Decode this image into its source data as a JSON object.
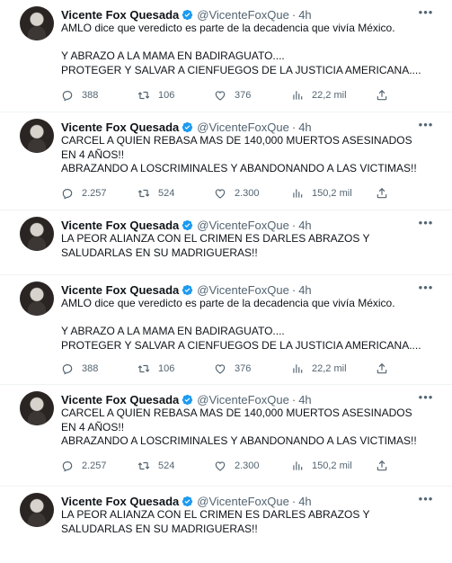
{
  "tweets": [
    {
      "name": "Vicente Fox Quesada",
      "handle": "@VicenteFoxQue",
      "time": "4h",
      "lines": [
        "AMLO dice que veredicto es parte de la decadencia que vivía México.",
        "",
        "Y ABRAZO A LA MAMA EN BADIRAGUATO....",
        "PROTEGER Y SALVAR A CIENFUEGOS DE LA JUSTICIA AMERICANA...."
      ],
      "replies": "388",
      "retweets": "106",
      "likes": "376",
      "views": "22,2 mil"
    },
    {
      "name": "Vicente Fox Quesada",
      "handle": "@VicenteFoxQue",
      "time": "4h",
      "lines": [
        "CARCEL A QUIEN REBASA MAS DE 140,000 MUERTOS ASESINADOS",
        "EN 4 AÑOS!!",
        "ABRAZANDO A LOSCRIMINALES Y ABANDONANDO A LAS VICTIMAS!!"
      ],
      "replies": "2.257",
      "retweets": "524",
      "likes": "2.300",
      "views": "150,2 mil"
    },
    {
      "name": "Vicente Fox Quesada",
      "handle": "@VicenteFoxQue",
      "time": "4h",
      "lines": [
        "LA PEOR ALIANZA CON EL CRIMEN ES DARLES ABRAZOS Y",
        "SALUDARLAS EN SU MADRIGUERAS!!"
      ]
    },
    {
      "name": "Vicente Fox Quesada",
      "handle": "@VicenteFoxQue",
      "time": "4h",
      "lines": [
        "AMLO dice que veredicto es parte de la decadencia que vivía México.",
        "",
        "Y ABRAZO A LA MAMA EN BADIRAGUATO....",
        "PROTEGER Y SALVAR A CIENFUEGOS DE LA JUSTICIA AMERICANA...."
      ],
      "replies": "388",
      "retweets": "106",
      "likes": "376",
      "views": "22,2 mil"
    },
    {
      "name": "Vicente Fox Quesada",
      "handle": "@VicenteFoxQue",
      "time": "4h",
      "lines": [
        "CARCEL A QUIEN REBASA MAS DE 140,000 MUERTOS ASESINADOS",
        "EN 4 AÑOS!!",
        "ABRAZANDO A LOSCRIMINALES Y ABANDONANDO A LAS VICTIMAS!!"
      ],
      "replies": "2.257",
      "retweets": "524",
      "likes": "2.300",
      "views": "150,2 mil"
    },
    {
      "name": "Vicente Fox Quesada",
      "handle": "@VicenteFoxQue",
      "time": "4h",
      "lines": [
        "LA PEOR ALIANZA CON EL CRIMEN ES DARLES ABRAZOS Y",
        "SALUDARLAS EN SU MADRIGUERAS!!"
      ]
    }
  ],
  "icons": {
    "more": "more-options-icon",
    "verified": "verified-badge-icon",
    "reply": "reply-icon",
    "retweet": "retweet-icon",
    "like": "like-heart-icon",
    "views": "views-chart-icon",
    "share": "share-icon"
  },
  "colors": {
    "text": "#0f1419",
    "secondary": "#536471",
    "verified": "#1d9bf0",
    "divider": "#eff3f4"
  }
}
